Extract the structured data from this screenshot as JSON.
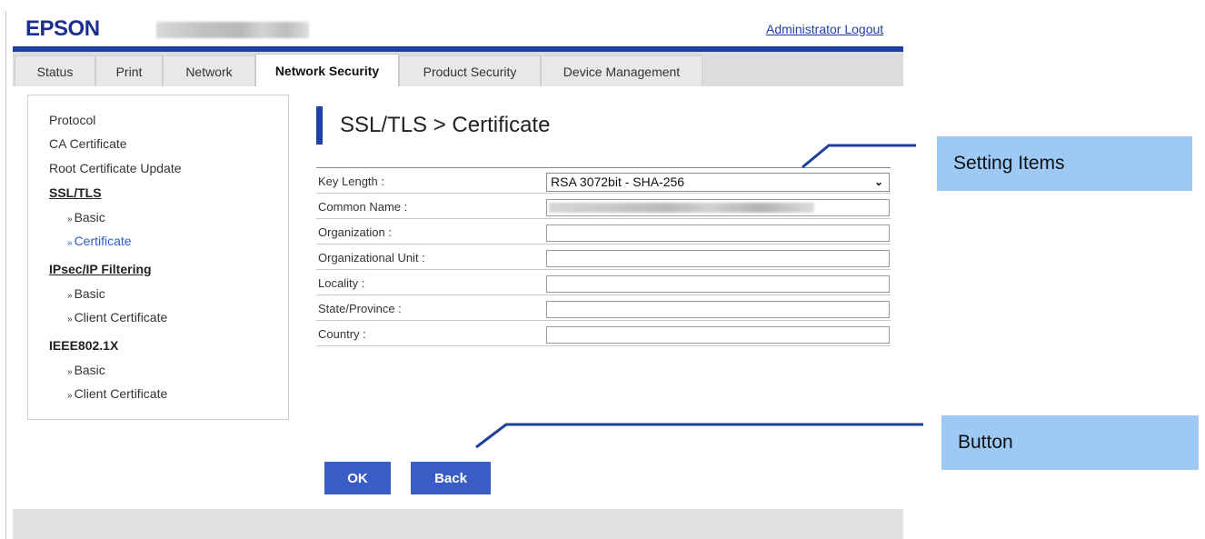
{
  "header": {
    "brand": "EPSON",
    "logout_label": "Administrator Logout"
  },
  "tabs": [
    {
      "label": "Status",
      "active": false
    },
    {
      "label": "Print",
      "active": false
    },
    {
      "label": "Network",
      "active": false
    },
    {
      "label": "Network Security",
      "active": true
    },
    {
      "label": "Product Security",
      "active": false
    },
    {
      "label": "Device Management",
      "active": false
    }
  ],
  "sidebar": {
    "items": [
      {
        "label": "Protocol",
        "type": "link"
      },
      {
        "label": "CA Certificate",
        "type": "link"
      },
      {
        "label": "Root Certificate Update",
        "type": "link"
      },
      {
        "label": "SSL/TLS",
        "type": "group"
      },
      {
        "label": "Basic",
        "type": "sub"
      },
      {
        "label": "Certificate",
        "type": "sub",
        "current": true
      },
      {
        "label": "IPsec/IP Filtering",
        "type": "group"
      },
      {
        "label": "Basic",
        "type": "sub"
      },
      {
        "label": "Client Certificate",
        "type": "sub"
      },
      {
        "label": "IEEE802.1X",
        "type": "group"
      },
      {
        "label": "Basic",
        "type": "sub"
      },
      {
        "label": "Client Certificate",
        "type": "sub"
      }
    ],
    "bullet": "»"
  },
  "main": {
    "title": "SSL/TLS > Certificate",
    "fields": [
      {
        "label": "Key Length :",
        "type": "select",
        "value": "RSA 3072bit - SHA-256"
      },
      {
        "label": "Common Name :",
        "type": "input",
        "value": ""
      },
      {
        "label": "Organization :",
        "type": "input",
        "value": ""
      },
      {
        "label": "Organizational Unit :",
        "type": "input",
        "value": ""
      },
      {
        "label": "Locality :",
        "type": "input",
        "value": ""
      },
      {
        "label": "State/Province :",
        "type": "input",
        "value": ""
      },
      {
        "label": "Country :",
        "type": "input",
        "value": ""
      }
    ],
    "ok_label": "OK",
    "back_label": "Back"
  },
  "annotations": {
    "setting_items": "Setting Items",
    "button": "Button"
  },
  "colors": {
    "brand_blue": "#1e40a5",
    "button_blue": "#3a5cc6",
    "callout_blue": "#9ec9f4",
    "link_blue": "#1e3faa"
  }
}
